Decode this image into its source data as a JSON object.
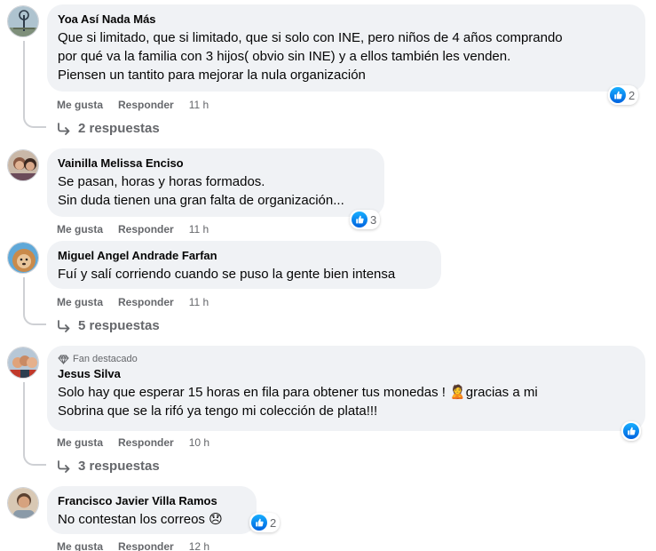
{
  "labels": {
    "like": "Me gusta",
    "reply": "Responder"
  },
  "colors": {
    "bubble": "#f0f2f5",
    "meta": "#65676b",
    "like_blue": "#1877f2"
  },
  "comments": [
    {
      "author": "Yoa Así Nada Más",
      "text": "Que si limitado, que si limitado, que si solo con INE, pero niños de 4 años comprando\npor qué va la familia con 3 hijos( obvio sin INE) y a ellos también les venden.\nPiensen un tantito para mejorar la nula organización",
      "time": "11 h",
      "reactions": "2",
      "replies": "2 respuestas"
    },
    {
      "author": "Vainilla Melissa Enciso",
      "text": "Se pasan, horas y horas formados.\nSin duda tienen una gran falta de organización...",
      "time": "11 h",
      "reactions": "3"
    },
    {
      "author": "Miguel Angel Andrade Farfan",
      "text": "Fuí y salí corriendo cuando se puso la gente bien intensa",
      "time": "11 h",
      "replies": "5 respuestas"
    },
    {
      "badge": "Fan destacado",
      "author": "Jesus Silva",
      "text": "Solo hay que esperar 15 horas en fila para obtener tus monedas ! 🙎gracias a mi\nSobrina que se la rifó ya tengo mi colección de plata!!!",
      "time": "10 h",
      "replies": "3 respuestas"
    },
    {
      "author": "Francisco Javier Villa Ramos",
      "text": "No contestan los correos 😞",
      "time": "12 h",
      "reactions": "2"
    }
  ]
}
